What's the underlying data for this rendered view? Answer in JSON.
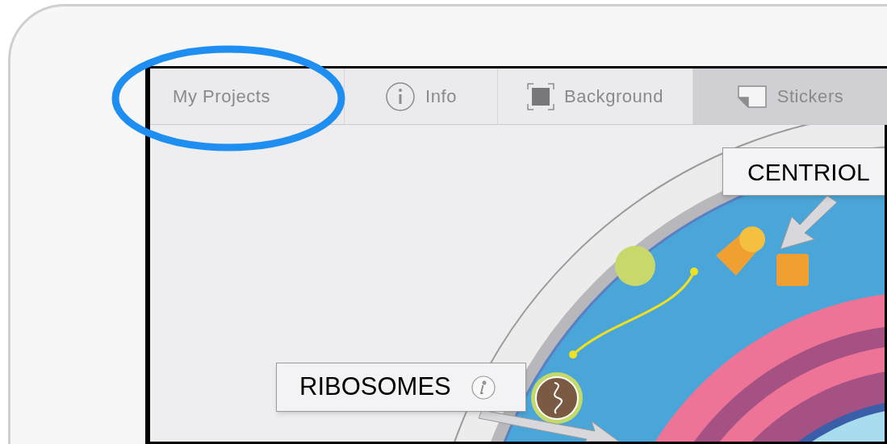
{
  "toolbar": {
    "tabs": [
      {
        "label": "My Projects",
        "selected": false
      },
      {
        "label": "Info",
        "selected": false
      },
      {
        "label": "Background",
        "selected": false
      },
      {
        "label": "Stickers",
        "selected": true
      }
    ]
  },
  "canvas": {
    "labels": [
      {
        "text": "CENTRIOL"
      },
      {
        "text": "RIBOSOMES"
      }
    ]
  }
}
